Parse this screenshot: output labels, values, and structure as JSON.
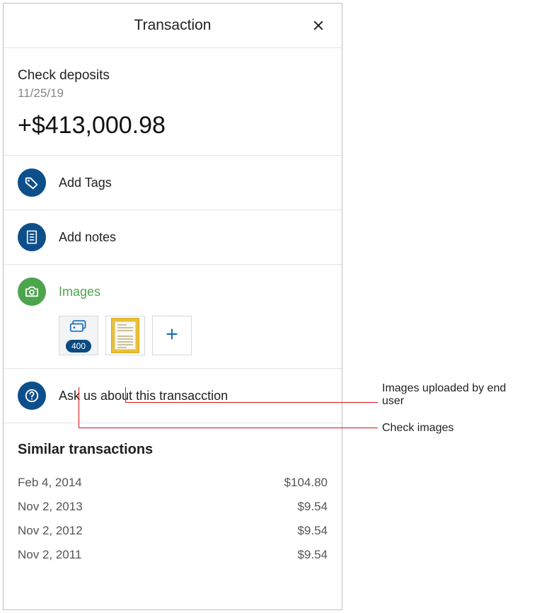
{
  "header": {
    "title": "Transaction"
  },
  "summary": {
    "category": "Check deposits",
    "date": "11/25/19",
    "amount": "+$413,000.98"
  },
  "actions": {
    "add_tags": "Add Tags",
    "add_notes": "Add notes",
    "images_label": "Images",
    "ask_us": "Ask us about this transacction"
  },
  "images": {
    "check_count": "400"
  },
  "similar": {
    "heading": "Similar transactions",
    "rows": [
      {
        "date": "Feb 4, 2014",
        "amount": "$104.80"
      },
      {
        "date": "Nov 2, 2013",
        "amount": "$9.54"
      },
      {
        "date": "Nov 2, 2012",
        "amount": "$9.54"
      },
      {
        "date": "Nov 2, 2011",
        "amount": "$9.54"
      }
    ]
  },
  "annotations": {
    "uploaded": "Images uploaded by end user",
    "check": "Check images"
  }
}
